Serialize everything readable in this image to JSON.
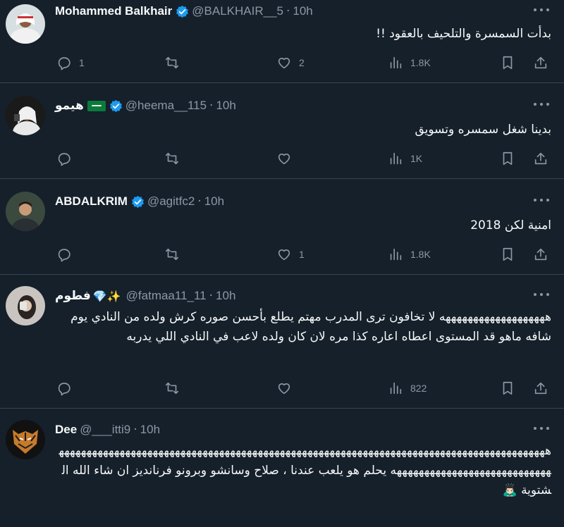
{
  "tweets": [
    {
      "name": "Mohammed Balkhair",
      "handle": "@BALKHAIR__5",
      "time": "10h",
      "text": "بدأت السمسرة والتلحيف بالعقود !!",
      "replies": "1",
      "retweets": "",
      "likes": "2",
      "views": "1.8K",
      "verified": true
    },
    {
      "name": "هيمو",
      "handle": "@heema__115",
      "time": "10h",
      "text": "بدينا  شغل  سمسره وتسويق",
      "replies": "",
      "retweets": "",
      "likes": "",
      "views": "1K",
      "verified": true,
      "flag": "saudi-flag"
    },
    {
      "name": "ABDALKRIM",
      "handle": "@agitfc2",
      "time": "10h",
      "text": "امنية لكن 2018",
      "replies": "",
      "retweets": "",
      "likes": "1",
      "views": "1.8K",
      "verified": true
    },
    {
      "name": "فطوم",
      "name_emoji": "💎✨",
      "handle": "@fatmaa11_11",
      "time": "10h",
      "text": "هههههههههههههههههههه لا تخافون ترى المدرب مهتم يطلع بأحسن صوره كرش ولده من النادي يوم شافه ماهو قد المستوى اعطاه اعاره كذا مره لان كان ولده لاعب في النادي اللي يدربه",
      "replies": "",
      "retweets": "",
      "likes": "",
      "views": "822"
    },
    {
      "name": "Dee",
      "handle": "@___itti9",
      "time": "10h",
      "text": "هههههههههههههههههههههههههههههههههههههههههههههههههههههههههههههههههههههههههههههههههههههههههههههههههههههههههههههههههههههه يحلم هو يلعب عندنا ، صلاح وسانشو وبرونو فرنانديز ان شاء الله الشتوية 🙇🏻‍♂️",
      "replies": "",
      "retweets": "",
      "likes": "",
      "views": ""
    }
  ],
  "colors": {
    "background": "#15202b",
    "text": "#f7f9f9",
    "muted": "#8b98a5",
    "verified": "#1d9bf0",
    "divider": "#38444d"
  },
  "icons": [
    "reply-icon",
    "retweet-icon",
    "like-icon",
    "views-icon",
    "bookmark-icon",
    "share-icon",
    "more-icon",
    "verified-badge-icon"
  ]
}
